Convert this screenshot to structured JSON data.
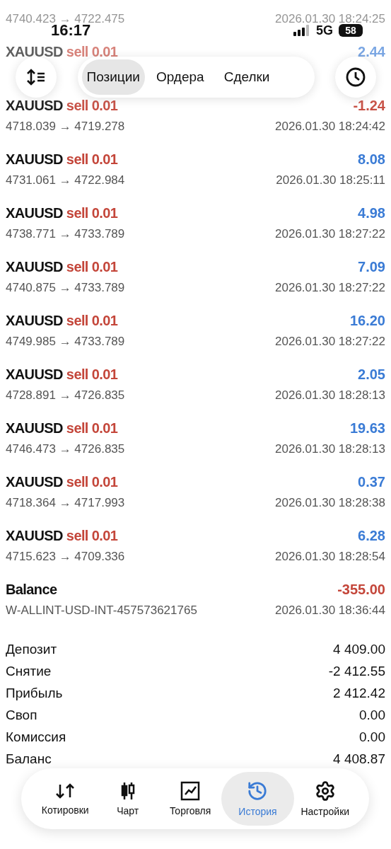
{
  "status_bar": {
    "time": "16:17",
    "network": "5G",
    "battery": "58"
  },
  "tabs": [
    {
      "label": "Позиции",
      "selected": true
    },
    {
      "label": "Ордера",
      "selected": false
    },
    {
      "label": "Сделки",
      "selected": false
    }
  ],
  "deals": [
    {
      "prices": "4740.423 → 4722.475",
      "time": "2026.01.30 18:24:25"
    },
    {
      "symbol": "XAUUSD",
      "side": "sell 0.01",
      "profit": "2.44",
      "negative": false
    },
    {
      "symbol": "XAUUSD",
      "side": "sell 0.01",
      "profit": "-1.24",
      "negative": true,
      "prices": "4718.039 → 4719.278",
      "time": "2026.01.30 18:24:42"
    },
    {
      "symbol": "XAUUSD",
      "side": "sell 0.01",
      "profit": "8.08",
      "negative": false,
      "prices": "4731.061 → 4722.984",
      "time": "2026.01.30 18:25:11"
    },
    {
      "symbol": "XAUUSD",
      "side": "sell 0.01",
      "profit": "4.98",
      "negative": false,
      "prices": "4738.771 → 4733.789",
      "time": "2026.01.30 18:27:22"
    },
    {
      "symbol": "XAUUSD",
      "side": "sell 0.01",
      "profit": "7.09",
      "negative": false,
      "prices": "4740.875 → 4733.789",
      "time": "2026.01.30 18:27:22"
    },
    {
      "symbol": "XAUUSD",
      "side": "sell 0.01",
      "profit": "16.20",
      "negative": false,
      "prices": "4749.985 → 4733.789",
      "time": "2026.01.30 18:27:22"
    },
    {
      "symbol": "XAUUSD",
      "side": "sell 0.01",
      "profit": "2.05",
      "negative": false,
      "prices": "4728.891 → 4726.835",
      "time": "2026.01.30 18:28:13"
    },
    {
      "symbol": "XAUUSD",
      "side": "sell 0.01",
      "profit": "19.63",
      "negative": false,
      "prices": "4746.473 → 4726.835",
      "time": "2026.01.30 18:28:13"
    },
    {
      "symbol": "XAUUSD",
      "side": "sell 0.01",
      "profit": "0.37",
      "negative": false,
      "prices": "4718.364 → 4717.993",
      "time": "2026.01.30 18:28:38"
    },
    {
      "symbol": "XAUUSD",
      "side": "sell 0.01",
      "profit": "6.28",
      "negative": false,
      "prices": "4715.623 → 4709.336",
      "time": "2026.01.30 18:28:54"
    },
    {
      "symbol": "Balance",
      "profit": "-355.00",
      "negative": true,
      "prices": "W-ALLINT-USD-INT-457573621765",
      "time": "2026.01.30 18:36:44"
    }
  ],
  "summary": [
    {
      "label": "Депозит",
      "value": "4 409.00"
    },
    {
      "label": "Снятие",
      "value": "-2 412.55"
    },
    {
      "label": "Прибыль",
      "value": "2 412.42"
    },
    {
      "label": "Своп",
      "value": "0.00"
    },
    {
      "label": "Комиссия",
      "value": "0.00"
    },
    {
      "label": "Баланс",
      "value": "4 408.87"
    }
  ],
  "nav": [
    {
      "label": "Котировки",
      "selected": false
    },
    {
      "label": "Чарт",
      "selected": false
    },
    {
      "label": "Торговля",
      "selected": false
    },
    {
      "label": "История",
      "selected": true
    },
    {
      "label": "Настройки",
      "selected": false
    }
  ]
}
